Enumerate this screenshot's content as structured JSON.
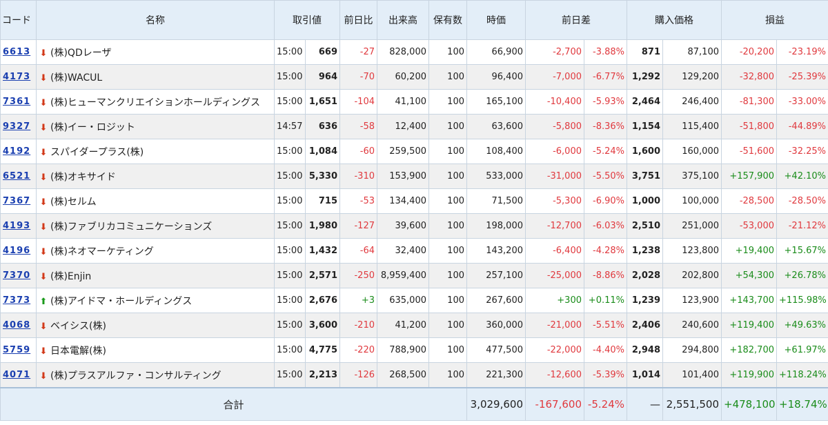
{
  "headers": {
    "code": "コード",
    "name": "名称",
    "price": "取引値",
    "change": "前日比",
    "volume": "出来高",
    "holdings": "保有数",
    "market_value": "時価",
    "day_diff": "前日差",
    "purchase_price": "購入価格",
    "pnl": "損益"
  },
  "rows": [
    {
      "code": "6613",
      "name": "(株)QDレーザ",
      "trend": "down",
      "time": "15:00",
      "price": "669",
      "change": "-27",
      "volume": "828,000",
      "holdings": "100",
      "value": "66,900",
      "diff": "-2,700",
      "diff_pct": "-3.88%",
      "buy_unit": "871",
      "buy_total": "87,100",
      "pnl": "-20,200",
      "pnl_pct": "-23.19%"
    },
    {
      "code": "4173",
      "name": "(株)WACUL",
      "trend": "down",
      "time": "15:00",
      "price": "964",
      "change": "-70",
      "volume": "60,200",
      "holdings": "100",
      "value": "96,400",
      "diff": "-7,000",
      "diff_pct": "-6.77%",
      "buy_unit": "1,292",
      "buy_total": "129,200",
      "pnl": "-32,800",
      "pnl_pct": "-25.39%"
    },
    {
      "code": "7361",
      "name": "(株)ヒューマンクリエイションホールディングス",
      "trend": "down",
      "time": "15:00",
      "price": "1,651",
      "change": "-104",
      "volume": "41,100",
      "holdings": "100",
      "value": "165,100",
      "diff": "-10,400",
      "diff_pct": "-5.93%",
      "buy_unit": "2,464",
      "buy_total": "246,400",
      "pnl": "-81,300",
      "pnl_pct": "-33.00%"
    },
    {
      "code": "9327",
      "name": "(株)イー・ロジット",
      "trend": "down",
      "time": "14:57",
      "price": "636",
      "change": "-58",
      "volume": "12,400",
      "holdings": "100",
      "value": "63,600",
      "diff": "-5,800",
      "diff_pct": "-8.36%",
      "buy_unit": "1,154",
      "buy_total": "115,400",
      "pnl": "-51,800",
      "pnl_pct": "-44.89%"
    },
    {
      "code": "4192",
      "name": "スパイダープラス(株)",
      "trend": "down",
      "time": "15:00",
      "price": "1,084",
      "change": "-60",
      "volume": "259,500",
      "holdings": "100",
      "value": "108,400",
      "diff": "-6,000",
      "diff_pct": "-5.24%",
      "buy_unit": "1,600",
      "buy_total": "160,000",
      "pnl": "-51,600",
      "pnl_pct": "-32.25%"
    },
    {
      "code": "6521",
      "name": "(株)オキサイド",
      "trend": "down",
      "time": "15:00",
      "price": "5,330",
      "change": "-310",
      "volume": "153,900",
      "holdings": "100",
      "value": "533,000",
      "diff": "-31,000",
      "diff_pct": "-5.50%",
      "buy_unit": "3,751",
      "buy_total": "375,100",
      "pnl": "+157,900",
      "pnl_pct": "+42.10%"
    },
    {
      "code": "7367",
      "name": "(株)セルム",
      "trend": "down",
      "time": "15:00",
      "price": "715",
      "change": "-53",
      "volume": "134,400",
      "holdings": "100",
      "value": "71,500",
      "diff": "-5,300",
      "diff_pct": "-6.90%",
      "buy_unit": "1,000",
      "buy_total": "100,000",
      "pnl": "-28,500",
      "pnl_pct": "-28.50%"
    },
    {
      "code": "4193",
      "name": "(株)ファブリカコミュニケーションズ",
      "trend": "down",
      "time": "15:00",
      "price": "1,980",
      "change": "-127",
      "volume": "39,600",
      "holdings": "100",
      "value": "198,000",
      "diff": "-12,700",
      "diff_pct": "-6.03%",
      "buy_unit": "2,510",
      "buy_total": "251,000",
      "pnl": "-53,000",
      "pnl_pct": "-21.12%"
    },
    {
      "code": "4196",
      "name": "(株)ネオマーケティング",
      "trend": "down",
      "time": "15:00",
      "price": "1,432",
      "change": "-64",
      "volume": "32,400",
      "holdings": "100",
      "value": "143,200",
      "diff": "-6,400",
      "diff_pct": "-4.28%",
      "buy_unit": "1,238",
      "buy_total": "123,800",
      "pnl": "+19,400",
      "pnl_pct": "+15.67%"
    },
    {
      "code": "7370",
      "name": "(株)Enjin",
      "trend": "down",
      "time": "15:00",
      "price": "2,571",
      "change": "-250",
      "volume": "8,959,400",
      "holdings": "100",
      "value": "257,100",
      "diff": "-25,000",
      "diff_pct": "-8.86%",
      "buy_unit": "2,028",
      "buy_total": "202,800",
      "pnl": "+54,300",
      "pnl_pct": "+26.78%"
    },
    {
      "code": "7373",
      "name": "(株)アイドマ・ホールディングス",
      "trend": "up",
      "time": "15:00",
      "price": "2,676",
      "change": "+3",
      "volume": "635,000",
      "holdings": "100",
      "value": "267,600",
      "diff": "+300",
      "diff_pct": "+0.11%",
      "buy_unit": "1,239",
      "buy_total": "123,900",
      "pnl": "+143,700",
      "pnl_pct": "+115.98%"
    },
    {
      "code": "4068",
      "name": "ベイシス(株)",
      "trend": "down",
      "time": "15:00",
      "price": "3,600",
      "change": "-210",
      "volume": "41,200",
      "holdings": "100",
      "value": "360,000",
      "diff": "-21,000",
      "diff_pct": "-5.51%",
      "buy_unit": "2,406",
      "buy_total": "240,600",
      "pnl": "+119,400",
      "pnl_pct": "+49.63%"
    },
    {
      "code": "5759",
      "name": "日本電解(株)",
      "trend": "down",
      "time": "15:00",
      "price": "4,775",
      "change": "-220",
      "volume": "788,900",
      "holdings": "100",
      "value": "477,500",
      "diff": "-22,000",
      "diff_pct": "-4.40%",
      "buy_unit": "2,948",
      "buy_total": "294,800",
      "pnl": "+182,700",
      "pnl_pct": "+61.97%"
    },
    {
      "code": "4071",
      "name": "(株)プラスアルファ・コンサルティング",
      "trend": "down",
      "time": "15:00",
      "price": "2,213",
      "change": "-126",
      "volume": "268,500",
      "holdings": "100",
      "value": "221,300",
      "diff": "-12,600",
      "diff_pct": "-5.39%",
      "buy_unit": "1,014",
      "buy_total": "101,400",
      "pnl": "+119,900",
      "pnl_pct": "+118.24%"
    }
  ],
  "total": {
    "label": "合計",
    "value": "3,029,600",
    "diff": "-167,600",
    "diff_pct": "-5.24%",
    "buy_unit": "—",
    "buy_total": "2,551,500",
    "pnl": "+478,100",
    "pnl_pct": "+18.74%"
  },
  "colors": {
    "header_bg": "#e3eef8",
    "negative": "#e0393e",
    "positive": "#1a8c1a",
    "link": "#1a3fb0",
    "down_arrow": "#d23a1a",
    "up_arrow": "#1a9a1a"
  },
  "icons": {
    "down": "arrow-down-icon",
    "up": "arrow-up-icon"
  }
}
